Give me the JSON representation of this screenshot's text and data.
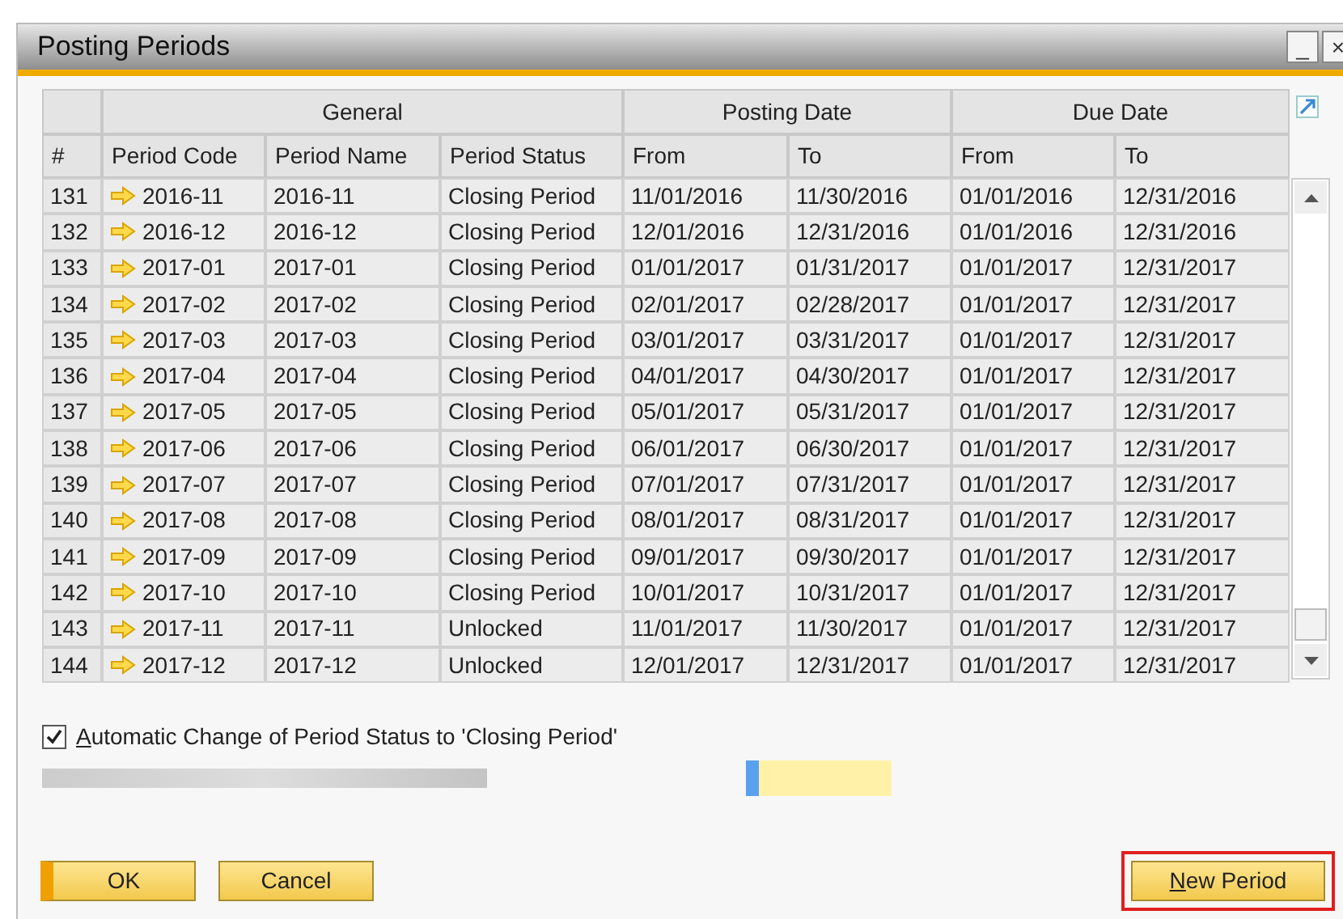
{
  "window": {
    "title": "Posting Periods",
    "controls": [
      "_",
      "×"
    ]
  },
  "table": {
    "groups": [
      "General",
      "Posting Date",
      "Due Date"
    ],
    "columns": [
      "#",
      "Period Code",
      "Period Name",
      "Period Status",
      "From",
      "To",
      "From",
      "To"
    ],
    "rows": [
      [
        "131",
        "2016-11",
        "2016-11",
        "Closing Period",
        "11/01/2016",
        "11/30/2016",
        "01/01/2016",
        "12/31/2016"
      ],
      [
        "132",
        "2016-12",
        "2016-12",
        "Closing Period",
        "12/01/2016",
        "12/31/2016",
        "01/01/2016",
        "12/31/2016"
      ],
      [
        "133",
        "2017-01",
        "2017-01",
        "Closing Period",
        "01/01/2017",
        "01/31/2017",
        "01/01/2017",
        "12/31/2017"
      ],
      [
        "134",
        "2017-02",
        "2017-02",
        "Closing Period",
        "02/01/2017",
        "02/28/2017",
        "01/01/2017",
        "12/31/2017"
      ],
      [
        "135",
        "2017-03",
        "2017-03",
        "Closing Period",
        "03/01/2017",
        "03/31/2017",
        "01/01/2017",
        "12/31/2017"
      ],
      [
        "136",
        "2017-04",
        "2017-04",
        "Closing Period",
        "04/01/2017",
        "04/30/2017",
        "01/01/2017",
        "12/31/2017"
      ],
      [
        "137",
        "2017-05",
        "2017-05",
        "Closing Period",
        "05/01/2017",
        "05/31/2017",
        "01/01/2017",
        "12/31/2017"
      ],
      [
        "138",
        "2017-06",
        "2017-06",
        "Closing Period",
        "06/01/2017",
        "06/30/2017",
        "01/01/2017",
        "12/31/2017"
      ],
      [
        "139",
        "2017-07",
        "2017-07",
        "Closing Period",
        "07/01/2017",
        "07/31/2017",
        "01/01/2017",
        "12/31/2017"
      ],
      [
        "140",
        "2017-08",
        "2017-08",
        "Closing Period",
        "08/01/2017",
        "08/31/2017",
        "01/01/2017",
        "12/31/2017"
      ],
      [
        "141",
        "2017-09",
        "2017-09",
        "Closing Period",
        "09/01/2017",
        "09/30/2017",
        "01/01/2017",
        "12/31/2017"
      ],
      [
        "142",
        "2017-10",
        "2017-10",
        "Closing Period",
        "10/01/2017",
        "10/31/2017",
        "01/01/2017",
        "12/31/2017"
      ],
      [
        "143",
        "2017-11",
        "2017-11",
        "Unlocked",
        "11/01/2017",
        "11/30/2017",
        "01/01/2017",
        "12/31/2017"
      ],
      [
        "144",
        "2017-12",
        "2017-12",
        "Unlocked",
        "12/01/2017",
        "12/31/2017",
        "01/01/2017",
        "12/31/2017"
      ]
    ]
  },
  "auto_change": {
    "label": "Automatic Change of Period Status to 'Closing Period'",
    "checked": true
  },
  "buttons": [
    {
      "label": "OK",
      "highlighted": false
    },
    {
      "label": "Cancel",
      "highlighted": false
    },
    {
      "label": "New Period",
      "highlighted": true
    }
  ]
}
